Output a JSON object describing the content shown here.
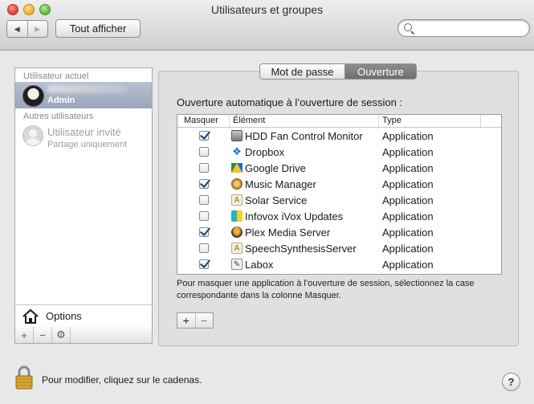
{
  "window": {
    "title": "Utilisateurs et groupes"
  },
  "toolbar": {
    "back_icon": "chevron-left-icon",
    "forward_icon": "chevron-right-icon",
    "show_all_label": "Tout afficher",
    "search_placeholder": ""
  },
  "sidebar": {
    "current_user_header": "Utilisateur actuel",
    "current_user": {
      "name": "Admin"
    },
    "other_users_header": "Autres utilisateurs",
    "other_users": [
      {
        "name": "Utilisateur invité",
        "subtitle": "Partage uniquement"
      }
    ],
    "options_label": "Options",
    "tools": [
      "+",
      "−",
      "⚙"
    ]
  },
  "tabs": [
    {
      "label": "Mot de passe",
      "selected": false
    },
    {
      "label": "Ouverture",
      "selected": true
    }
  ],
  "login_items": {
    "heading": "Ouverture automatique à l’ouverture de session :",
    "columns": {
      "hide": "Masquer",
      "item": "Élément",
      "type": "Type"
    },
    "rows": [
      {
        "hidden": true,
        "name": "HDD Fan Control Monitor",
        "type": "Application",
        "icon": "hdd-icon"
      },
      {
        "hidden": false,
        "name": "Dropbox",
        "type": "Application",
        "icon": "dropbox-icon"
      },
      {
        "hidden": false,
        "name": "Google Drive",
        "type": "Application",
        "icon": "google-drive-icon"
      },
      {
        "hidden": true,
        "name": "Music Manager",
        "type": "Application",
        "icon": "music-manager-icon"
      },
      {
        "hidden": false,
        "name": "Solar Service",
        "type": "Application",
        "icon": "solar-service-icon"
      },
      {
        "hidden": false,
        "name": "Infovox iVox Updates",
        "type": "Application",
        "icon": "infovox-icon"
      },
      {
        "hidden": true,
        "name": "Plex Media Server",
        "type": "Application",
        "icon": "plex-icon"
      },
      {
        "hidden": false,
        "name": "SpeechSynthesisServer",
        "type": "Application",
        "icon": "speech-server-icon"
      },
      {
        "hidden": true,
        "name": "Labox",
        "type": "Application",
        "icon": "labox-icon"
      }
    ],
    "hint": "Pour masquer une application à l’ouverture de session, sélectionnez la case correspondante dans la colonne Masquer.",
    "add_label": "+",
    "remove_label": "−"
  },
  "footer": {
    "lock_text": "Pour modifier, cliquez sur le cadenas.",
    "help_label": "?"
  }
}
